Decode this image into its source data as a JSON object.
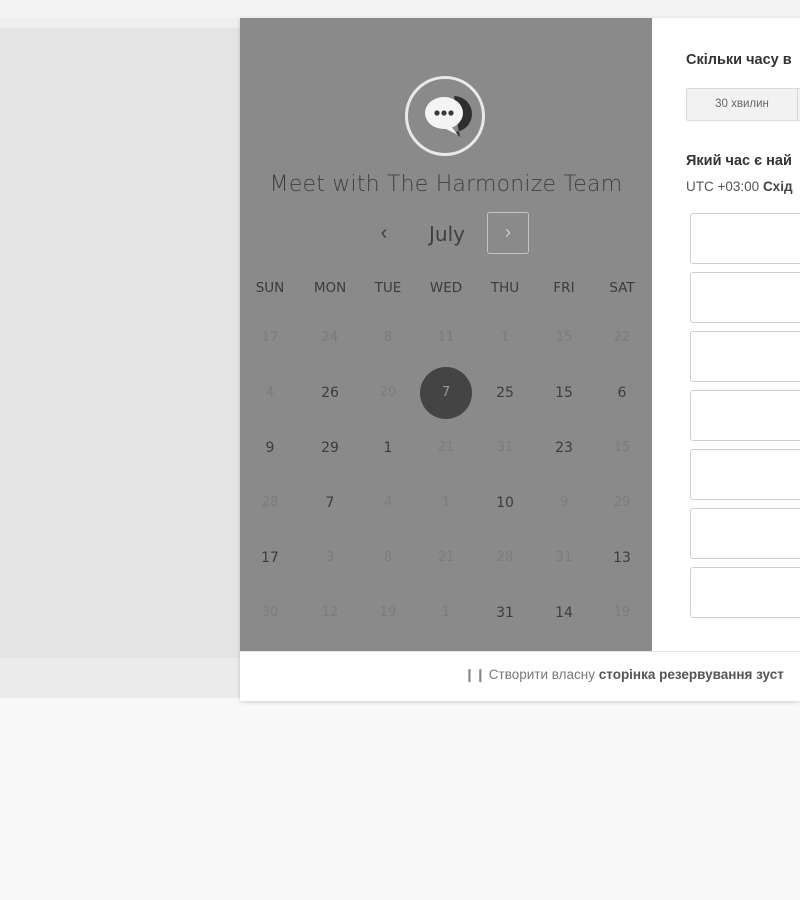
{
  "calendar": {
    "title": "Meet with The Harmonize Team",
    "month": "July",
    "weekdays": [
      "SUN",
      "MON",
      "TUE",
      "WED",
      "THU",
      "FRI",
      "SAT"
    ],
    "weeks": [
      [
        {
          "d": "17",
          "active": false
        },
        {
          "d": "24",
          "active": false
        },
        {
          "d": "8",
          "active": false
        },
        {
          "d": "11",
          "active": false
        },
        {
          "d": "1",
          "active": false
        },
        {
          "d": "15",
          "active": false
        },
        {
          "d": "22",
          "active": false
        }
      ],
      [
        {
          "d": "4",
          "active": false
        },
        {
          "d": "26",
          "active": true
        },
        {
          "d": "20",
          "active": false
        },
        {
          "d": "7",
          "active": true,
          "selected": true
        },
        {
          "d": "25",
          "active": true
        },
        {
          "d": "15",
          "active": true
        },
        {
          "d": "6",
          "active": true
        }
      ],
      [
        {
          "d": "9",
          "active": true
        },
        {
          "d": "29",
          "active": true
        },
        {
          "d": "1",
          "active": true
        },
        {
          "d": "21",
          "active": false
        },
        {
          "d": "31",
          "active": false
        },
        {
          "d": "23",
          "active": true
        },
        {
          "d": "15",
          "active": false
        }
      ],
      [
        {
          "d": "28",
          "active": false
        },
        {
          "d": "7",
          "active": true
        },
        {
          "d": "4",
          "active": false
        },
        {
          "d": "1",
          "active": false
        },
        {
          "d": "10",
          "active": true
        },
        {
          "d": "9",
          "active": false
        },
        {
          "d": "29",
          "active": false
        }
      ],
      [
        {
          "d": "17",
          "active": true
        },
        {
          "d": "3",
          "active": false
        },
        {
          "d": "8",
          "active": false
        },
        {
          "d": "21",
          "active": false
        },
        {
          "d": "28",
          "active": false
        },
        {
          "d": "31",
          "active": false
        },
        {
          "d": "13",
          "active": true
        }
      ],
      [
        {
          "d": "30",
          "active": false
        },
        {
          "d": "12",
          "active": false
        },
        {
          "d": "19",
          "active": false
        },
        {
          "d": "1",
          "active": false
        },
        {
          "d": "31",
          "active": true
        },
        {
          "d": "14",
          "active": true
        },
        {
          "d": "19",
          "active": false
        }
      ]
    ]
  },
  "right": {
    "duration_question": "Скільки часу в",
    "duration_option": "30 хвилин",
    "time_question": "Який час є най",
    "tz_prefix": "UTC +03:00",
    "tz_name": "Схід",
    "slot_count": 7
  },
  "footer": {
    "text_plain": "Створити власну",
    "text_bold": "сторінка резервування зуст"
  }
}
